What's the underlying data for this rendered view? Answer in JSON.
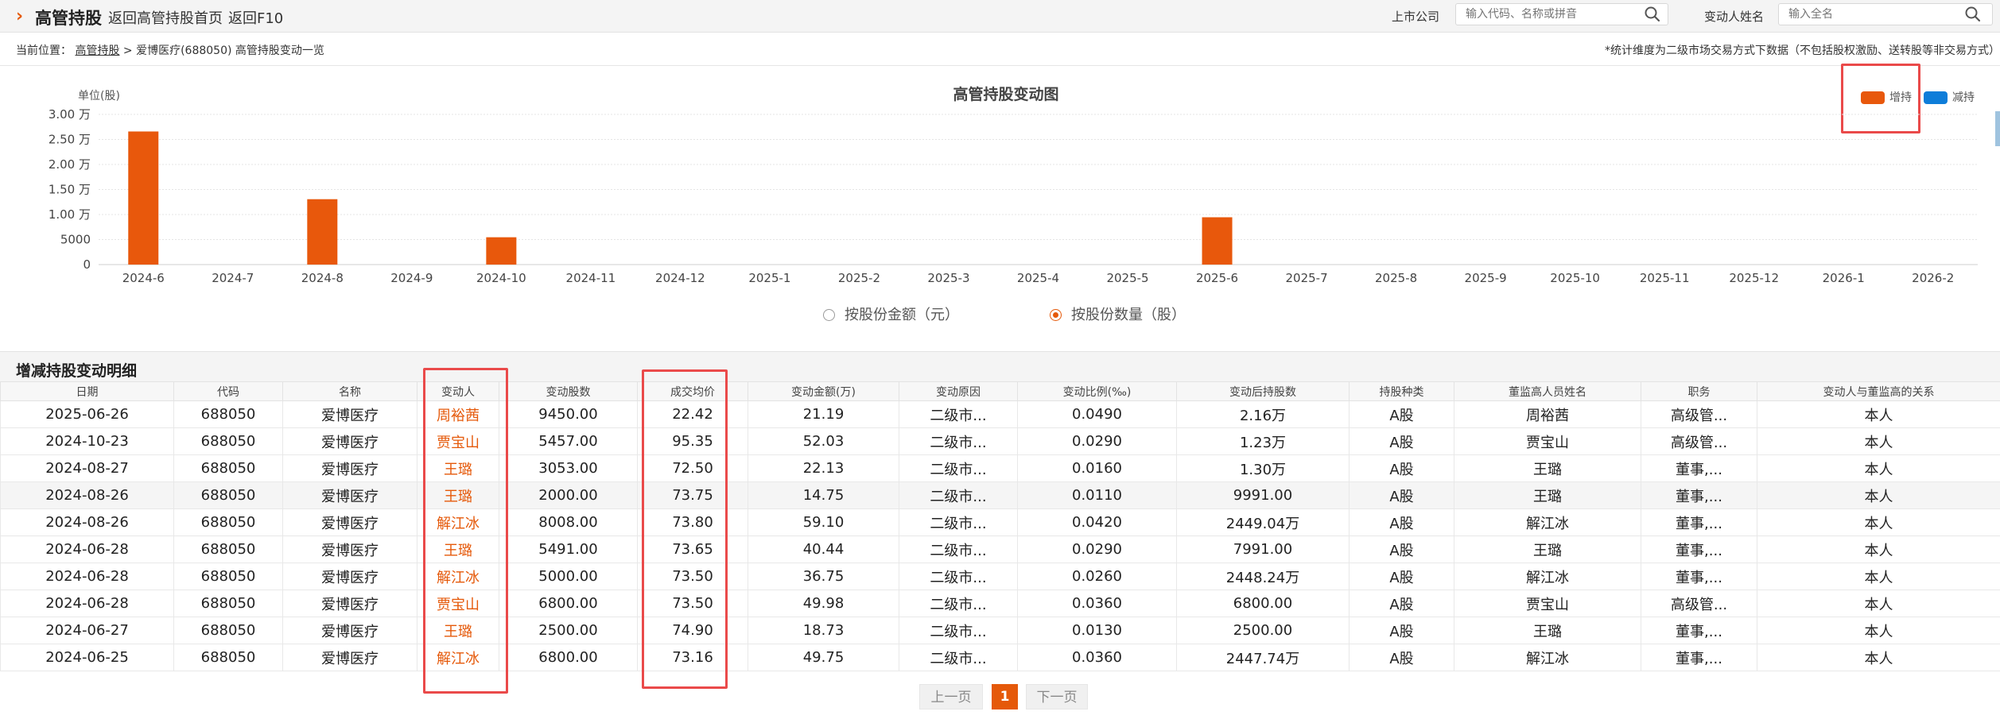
{
  "header": {
    "arrow": "›",
    "title": "高管持股",
    "links": [
      "返回高管持股首页",
      "返回F10"
    ],
    "company_label": "上市公司",
    "company_placeholder": "输入代码、名称或拼音",
    "person_label": "变动人姓名",
    "person_placeholder": "输入全名"
  },
  "breadcrumb": {
    "prefix": "当前位置：",
    "home": "高管持股",
    "sep": " > ",
    "current": "爱博医疗(688050) 高管持股变动一览"
  },
  "note": "*统计维度为二级市场交易方式下数据（不包括股权激励、送转股等非交易方式）",
  "chart_data": {
    "type": "bar",
    "title": "高管持股变动图",
    "ylabel": "单位(股)",
    "ylim": [
      0,
      30000
    ],
    "y_ticks": [
      "0",
      "5000",
      "1.00 万",
      "1.50 万",
      "2.00 万",
      "2.50 万",
      "3.00 万"
    ],
    "grid": true,
    "legend_position": "top-right",
    "categories": [
      "2024-6",
      "2024-7",
      "2024-8",
      "2024-9",
      "2024-10",
      "2024-11",
      "2024-12",
      "2025-1",
      "2025-2",
      "2025-3",
      "2025-4",
      "2025-5",
      "2025-6",
      "2025-7",
      "2025-8",
      "2025-9",
      "2025-10",
      "2025-11",
      "2025-12",
      "2026-1",
      "2026-2"
    ],
    "series": [
      {
        "name": "增持",
        "color": "#e8580c",
        "values": [
          26591,
          0,
          13061,
          0,
          5457,
          0,
          0,
          0,
          0,
          0,
          0,
          0,
          9450,
          0,
          0,
          0,
          0,
          0,
          0,
          0,
          0
        ]
      },
      {
        "name": "减持",
        "color": "#0e7dd9",
        "values": [
          0,
          0,
          0,
          0,
          0,
          0,
          0,
          0,
          0,
          0,
          0,
          0,
          0,
          0,
          0,
          0,
          0,
          0,
          0,
          0,
          0
        ]
      }
    ]
  },
  "radios": {
    "amount": "按股份金额（元）",
    "quantity": "按股份数量（股）",
    "selected": "quantity"
  },
  "section_title": "增减持股变动明细",
  "table": {
    "headers": [
      "日期",
      "代码",
      "名称",
      "变动人",
      "变动股数",
      "成交均价",
      "变动金额(万)",
      "变动原因",
      "变动比例(‰)",
      "变动后持股数",
      "持股种类",
      "董监高人员姓名",
      "职务",
      "变动人与董监高的关系"
    ],
    "rows": [
      [
        "2025-06-26",
        "688050",
        "爱博医疗",
        "周裕茜",
        "9450.00",
        "22.42",
        "21.19",
        "二级市...",
        "0.0490",
        "2.16万",
        "A股",
        "周裕茜",
        "高级管...",
        "本人"
      ],
      [
        "2024-10-23",
        "688050",
        "爱博医疗",
        "贾宝山",
        "5457.00",
        "95.35",
        "52.03",
        "二级市...",
        "0.0290",
        "1.23万",
        "A股",
        "贾宝山",
        "高级管...",
        "本人"
      ],
      [
        "2024-08-27",
        "688050",
        "爱博医疗",
        "王璐",
        "3053.00",
        "72.50",
        "22.13",
        "二级市...",
        "0.0160",
        "1.30万",
        "A股",
        "王璐",
        "董事,...",
        "本人"
      ],
      [
        "2024-08-26",
        "688050",
        "爱博医疗",
        "王璐",
        "2000.00",
        "73.75",
        "14.75",
        "二级市...",
        "0.0110",
        "9991.00",
        "A股",
        "王璐",
        "董事,...",
        "本人"
      ],
      [
        "2024-08-26",
        "688050",
        "爱博医疗",
        "解江冰",
        "8008.00",
        "73.80",
        "59.10",
        "二级市...",
        "0.0420",
        "2449.04万",
        "A股",
        "解江冰",
        "董事,...",
        "本人"
      ],
      [
        "2024-06-28",
        "688050",
        "爱博医疗",
        "王璐",
        "5491.00",
        "73.65",
        "40.44",
        "二级市...",
        "0.0290",
        "7991.00",
        "A股",
        "王璐",
        "董事,...",
        "本人"
      ],
      [
        "2024-06-28",
        "688050",
        "爱博医疗",
        "解江冰",
        "5000.00",
        "73.50",
        "36.75",
        "二级市...",
        "0.0260",
        "2448.24万",
        "A股",
        "解江冰",
        "董事,...",
        "本人"
      ],
      [
        "2024-06-28",
        "688050",
        "爱博医疗",
        "贾宝山",
        "6800.00",
        "73.50",
        "49.98",
        "二级市...",
        "0.0360",
        "6800.00",
        "A股",
        "贾宝山",
        "高级管...",
        "本人"
      ],
      [
        "2024-06-27",
        "688050",
        "爱博医疗",
        "王璐",
        "2500.00",
        "74.90",
        "18.73",
        "二级市...",
        "0.0130",
        "2500.00",
        "A股",
        "王璐",
        "董事,...",
        "本人"
      ],
      [
        "2024-06-25",
        "688050",
        "爱博医疗",
        "解江冰",
        "6800.00",
        "73.16",
        "49.75",
        "二级市...",
        "0.0360",
        "2447.74万",
        "A股",
        "解江冰",
        "董事,...",
        "本人"
      ]
    ],
    "highlighted_row": 3
  },
  "pagination": {
    "prev": "上一页",
    "current": "1",
    "next": "下一页"
  },
  "colors": {
    "accent": "#e5590a",
    "annotation_box": "#ea4a4a"
  }
}
